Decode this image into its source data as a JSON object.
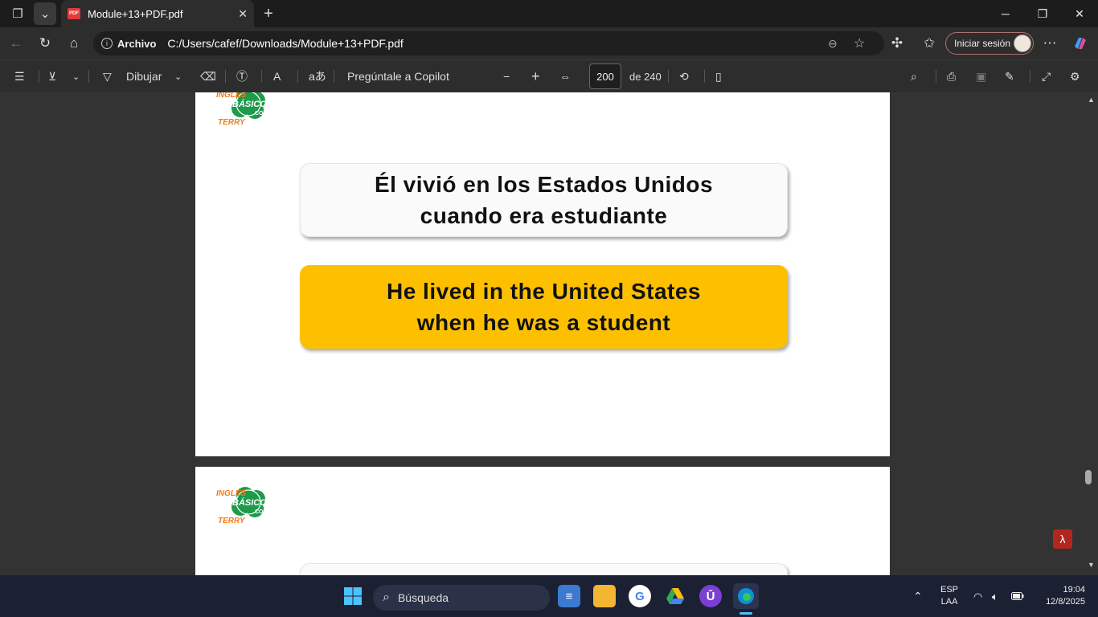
{
  "browser": {
    "tab_title": "Module+13+PDF.pdf",
    "pdf_badge": "PDF",
    "url_origin": "Archivo",
    "url_path": "C:/Users/cafef/Downloads/Module+13+PDF.pdf",
    "signin_label": "Iniciar sesión"
  },
  "pdf_toolbar": {
    "draw_label": "Dibujar",
    "copilot_label": "Pregúntale a Copilot",
    "current_page": "200",
    "total_pages": "de 240"
  },
  "pages": [
    {
      "logo": {
        "line1": "INGLÉS",
        "line2": "BÁSICO",
        "line3": "CON",
        "line4": "TERRY"
      },
      "spanish": {
        "line1": "Él vivió en los Estados Unidos",
        "line2": "cuando era estudiante"
      },
      "english": {
        "line1": "He lived in the United States",
        "line2": "when he was a student"
      }
    },
    {
      "logo": {
        "line1": "INGLÉS",
        "line2": "BÁSICO",
        "line3": "CON",
        "line4": "TERRY"
      }
    }
  ],
  "taskbar": {
    "search_placeholder": "Búsqueda",
    "lang_line1": "ESP",
    "lang_line2": "LAA",
    "time": "19:04",
    "date": "12/8/2025"
  },
  "colors": {
    "accent_yellow": "#fdc000",
    "logo_green": "#1e9a4a",
    "logo_orange": "#f07d1a"
  }
}
